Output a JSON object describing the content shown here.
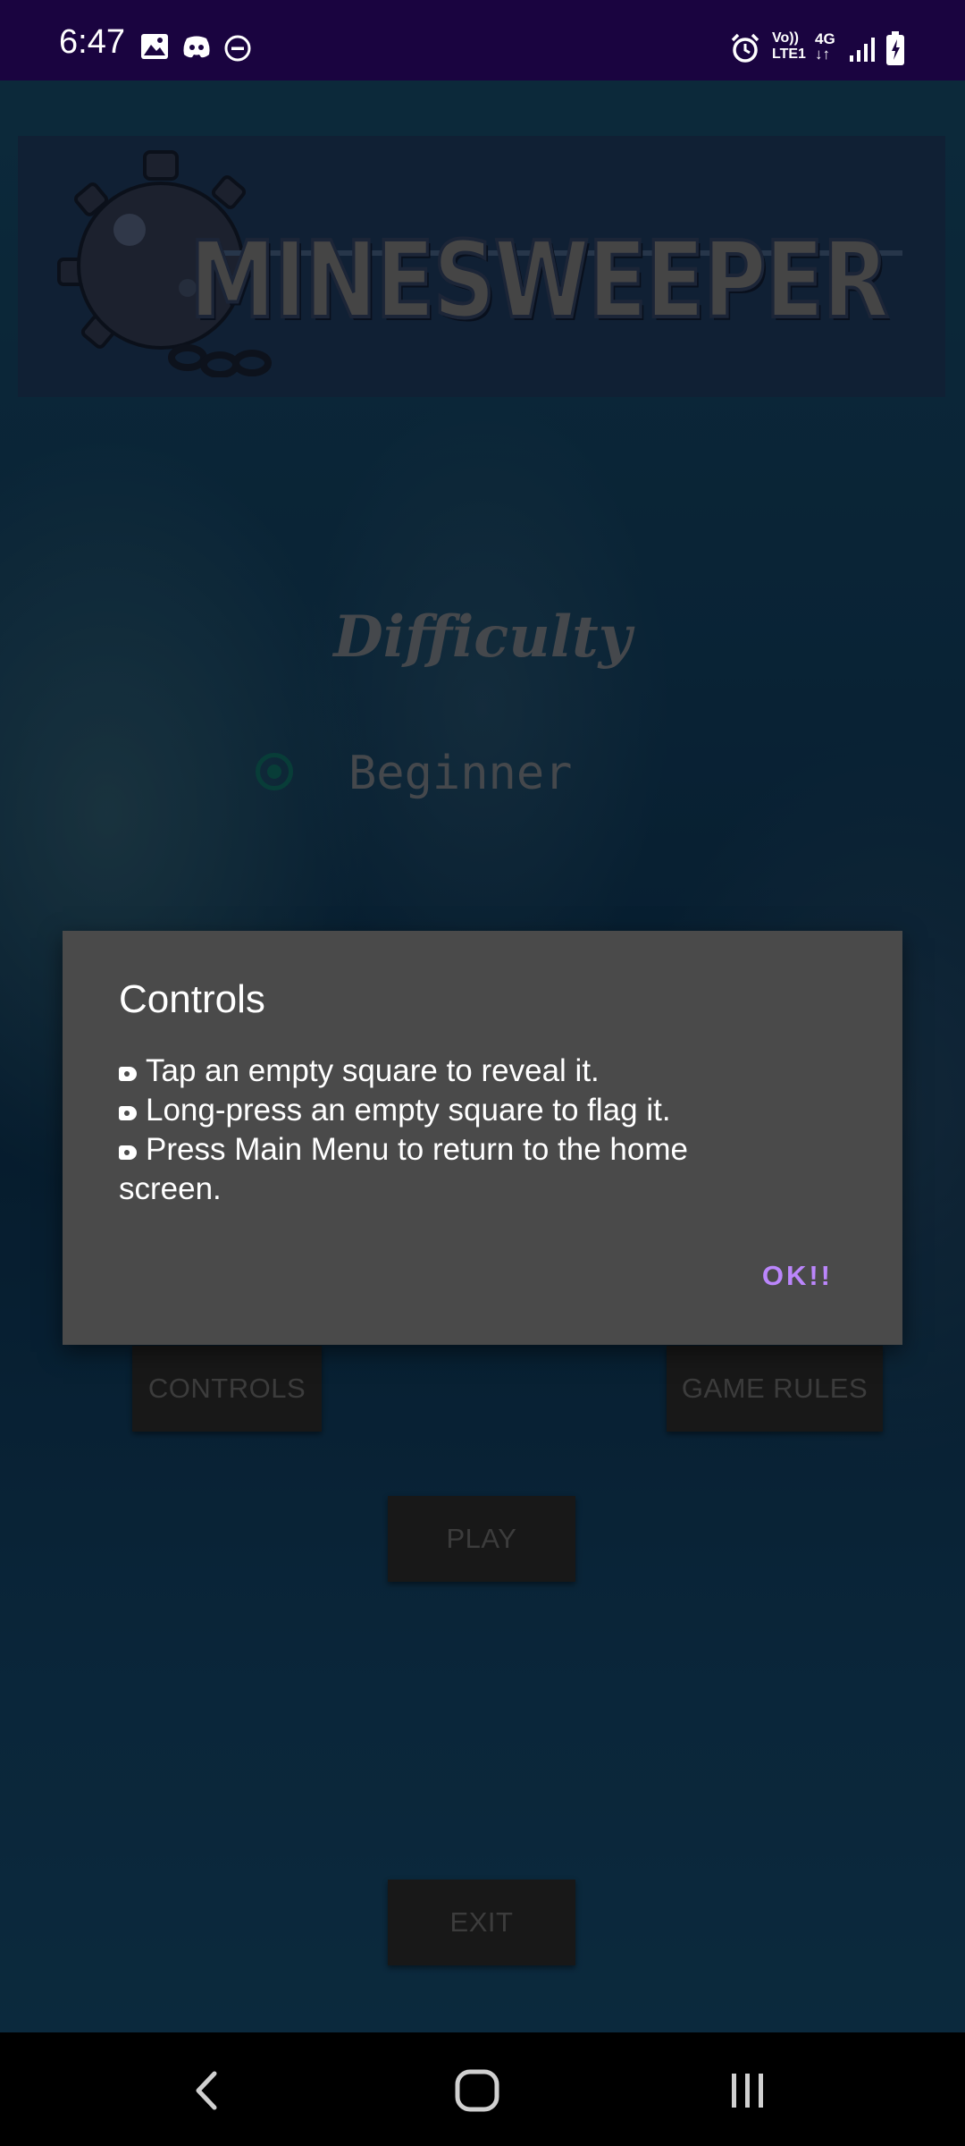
{
  "status_bar": {
    "time": "6:47",
    "left_icons": [
      "image-icon",
      "discord-icon",
      "do-not-disturb-icon"
    ],
    "right_icons": [
      "alarm-icon",
      "volte-icon",
      "4g-icon",
      "signal-icon",
      "battery-charging-icon"
    ],
    "volte_text": "Vo)) LTE1",
    "network_text": "4G"
  },
  "logo": {
    "title": "MINESWEEPER",
    "icon": "sea-mine-icon"
  },
  "difficulty": {
    "heading": "Difficulty",
    "selected_option": "Beginner"
  },
  "buttons": {
    "controls": "CONTROLS",
    "game_rules": "GAME RULES",
    "play": "PLAY",
    "exit": "EXIT"
  },
  "dialog": {
    "title": "Controls",
    "lines": [
      "Tap an empty square to reveal it.",
      "Long-press an empty square to flag it.",
      "Press Main Menu to return to the home screen."
    ],
    "ok_label": "OK!!"
  },
  "nav_bar": {
    "icons": [
      "back-icon",
      "home-icon",
      "recents-icon"
    ]
  },
  "colors": {
    "status_bar": "#1a0440",
    "dialog_bg": "#4a4a4a",
    "accent": "#bb86fc",
    "radio": "#0d5f56"
  }
}
